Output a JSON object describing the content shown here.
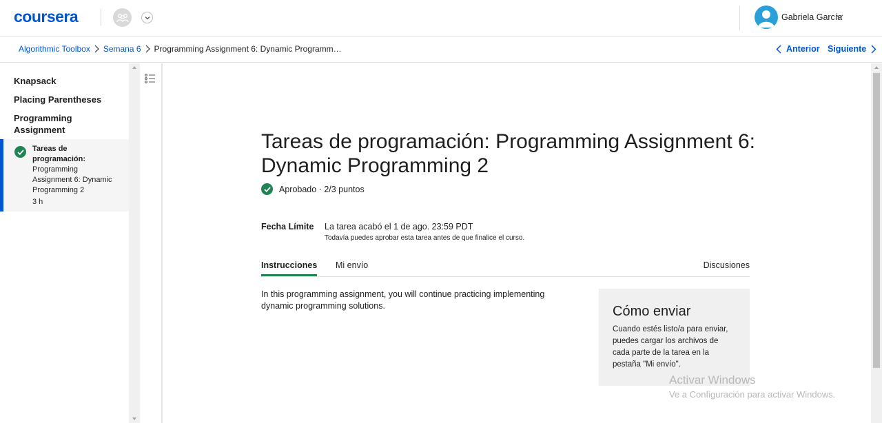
{
  "header": {
    "logo": "coursera",
    "user_name": "Gabriela García"
  },
  "breadcrumb": {
    "items": [
      "Algorithmic Toolbox",
      "Semana 6"
    ],
    "current": "Programming Assignment 6: Dynamic Programm…",
    "prev_label": "Anterior",
    "next_label": "Siguiente"
  },
  "sidebar": {
    "sections": [
      "Knapsack",
      "Placing Parentheses",
      "Programming Assignment"
    ],
    "active_item": {
      "title_bold": "Tareas de programación:",
      "title_rest": "Programming Assignment 6: Dynamic Programming 2",
      "duration": "3 h"
    }
  },
  "main": {
    "title": "Tareas de programación: Programming Assignment 6: Dynamic Programming 2",
    "status": "Aprobado · 2/3 puntos",
    "deadline_label": "Fecha Límite",
    "deadline_value": "La tarea acabó el 1 de ago. 23:59 PDT",
    "deadline_note": "Todavía puedes aprobar esta tarea antes de que finalice el curso.",
    "tabs": [
      "Instrucciones",
      "Mi envío",
      "Discusiones"
    ],
    "instructions": "In this programming assignment, you will continue practicing implementing dynamic programming solutions.",
    "howto_title": "Cómo enviar",
    "howto_body": "Cuando estés listo/a para enviar, puedes cargar los archivos de cada parte de la tarea en la pestaña \"Mi envío\"."
  },
  "watermark": {
    "line1": "Activar Windows",
    "line2": "Ve a Configuración para activar Windows."
  },
  "colors": {
    "brand": "#0056d2",
    "success": "#1f8354"
  }
}
